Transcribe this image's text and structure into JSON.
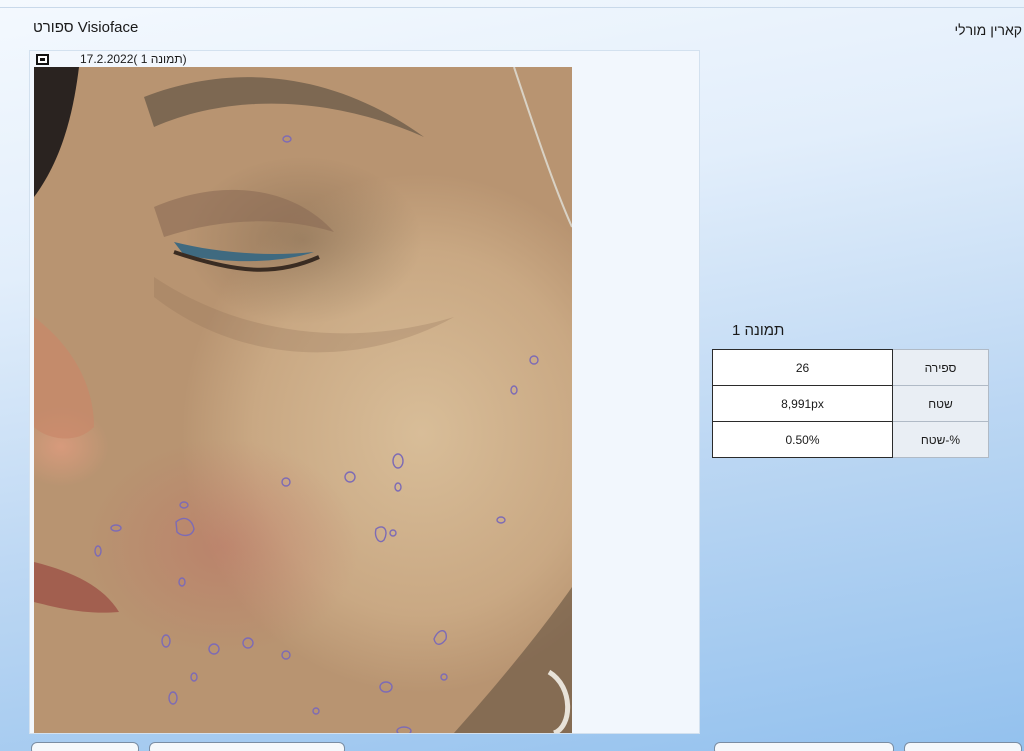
{
  "header": {
    "title": "ספורט Visioface",
    "user_name": "קארין מורלי"
  },
  "image_panel": {
    "caption": "(תמונה 1 )17.2.2022"
  },
  "results": {
    "title": "תמונה 1",
    "rows": [
      {
        "label": "ספירה",
        "value": "26"
      },
      {
        "label": "שטח",
        "value": "8,991px"
      },
      {
        "label": "%-שטח",
        "value": "0.50%"
      }
    ]
  },
  "colors": {
    "spot_outline": "#7d6bb5",
    "eyeliner": "#3f6a80"
  },
  "icons": {
    "panel_toggle": "square-toggle-icon"
  }
}
